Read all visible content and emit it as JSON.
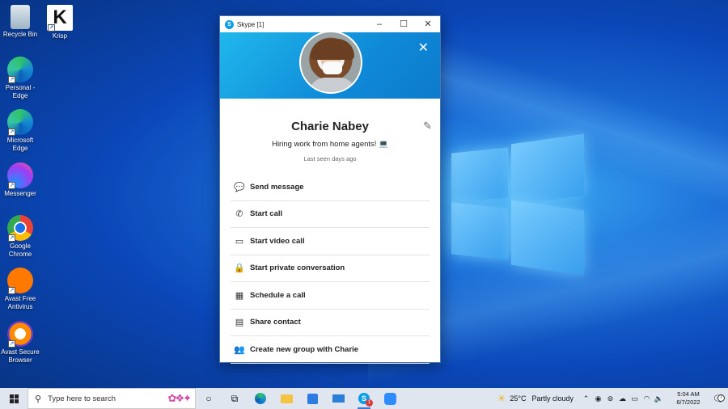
{
  "desktop": {
    "icons": [
      {
        "label": "Recycle Bin",
        "icon": "recycle-bin-icon"
      },
      {
        "label": "Krisp",
        "icon": "krisp-icon"
      },
      {
        "label": "Personal - Edge",
        "icon": "edge-icon"
      },
      {
        "label": "Microsoft Edge",
        "icon": "edge-icon"
      },
      {
        "label": "Messenger",
        "icon": "messenger-icon"
      },
      {
        "label": "Google Chrome",
        "icon": "chrome-icon"
      },
      {
        "label": "Avast Free Antivirus",
        "icon": "avast-icon"
      },
      {
        "label": "Avast Secure Browser",
        "icon": "avast-browser-icon"
      }
    ]
  },
  "skype": {
    "title": "Skype [1]",
    "profile": {
      "name": "Charie Nabey",
      "mood": "Hiring work from home agents! 💻",
      "last_seen": "Last seen days ago"
    },
    "actions": [
      {
        "label": "Send message",
        "icon": "chat-icon"
      },
      {
        "label": "Start call",
        "icon": "phone-icon"
      },
      {
        "label": "Start video call",
        "icon": "video-icon"
      },
      {
        "label": "Start private conversation",
        "icon": "lock-icon"
      },
      {
        "label": "Schedule a call",
        "icon": "calendar-icon"
      },
      {
        "label": "Share contact",
        "icon": "contact-card-icon"
      },
      {
        "label": "Create new group with Charie",
        "icon": "group-icon"
      }
    ]
  },
  "taskbar": {
    "search_placeholder": "Type here to search",
    "weather_temp": "25°C",
    "weather_desc": "Partly cloudy",
    "time": "5:04 AM",
    "date": "6/7/2022",
    "notification_count": "7",
    "skype_badge": "1"
  }
}
